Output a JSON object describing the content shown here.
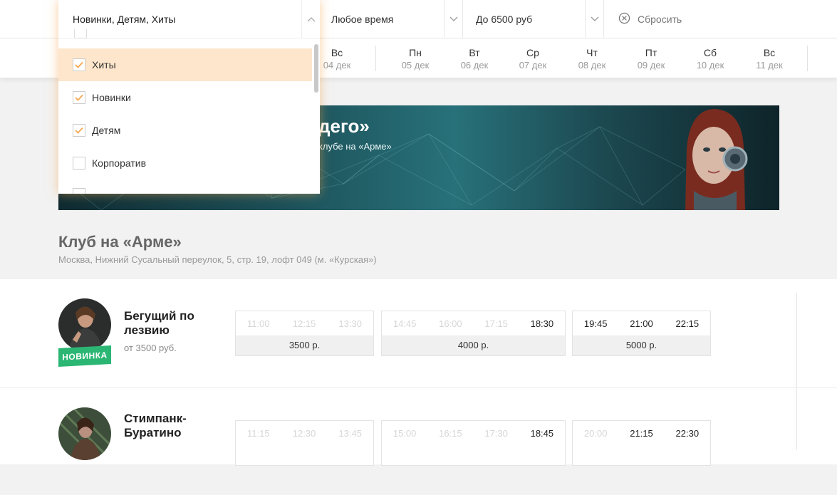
{
  "filters": {
    "category_value": "Новинки, Детям, Хиты",
    "time_value": "Любое время",
    "price_value": "До 6500 руб",
    "reset_label": "Сбросить"
  },
  "dates": [
    {
      "weekday": "Вс",
      "date": "04 дек"
    },
    {
      "weekday": "Пн",
      "date": "05 дек"
    },
    {
      "weekday": "Вт",
      "date": "06 дек"
    },
    {
      "weekday": "Ср",
      "date": "07 дек"
    },
    {
      "weekday": "Чт",
      "date": "08 дек"
    },
    {
      "weekday": "Пт",
      "date": "09 дек"
    },
    {
      "weekday": "Сб",
      "date": "10 дек"
    },
    {
      "weekday": "Вс",
      "date": "11 дек"
    }
  ],
  "dropdown": {
    "items": [
      {
        "label": "Хиты",
        "checked": true
      },
      {
        "label": "Новинки",
        "checked": true
      },
      {
        "label": "Детям",
        "checked": true
      },
      {
        "label": "Корпоратив",
        "checked": false
      }
    ]
  },
  "banner": {
    "title": "дего»",
    "subtitle": "клубе на «Арме»"
  },
  "venue": {
    "name": "Клуб на «Арме»",
    "address": "Москва, Нижний Сусальный переулок, 5, стр. 19, лофт 049 (м. «Курская»)"
  },
  "events": [
    {
      "title": "Бегущий по лезвию",
      "badge": "НОВИНКА",
      "price": "от 3500 руб.",
      "slots": [
        {
          "times": [
            "11:00",
            "12:15",
            "13:30"
          ],
          "price": "3500 р."
        },
        {
          "times": [
            "14:45",
            "16:00",
            "17:15",
            "18:30"
          ],
          "price": "4000 р."
        },
        {
          "times": [
            "19:45",
            "21:00",
            "22:15"
          ],
          "price": "5000 р."
        }
      ]
    },
    {
      "title": "Стимпанк-Буратино",
      "slots": [
        {
          "times": [
            "11:15",
            "12:30",
            "13:45"
          ]
        },
        {
          "times": [
            "15:00",
            "16:15",
            "17:30",
            "18:45"
          ]
        },
        {
          "times": [
            "20:00",
            "21:15",
            "22:30"
          ]
        }
      ]
    }
  ],
  "colors": {
    "accent_orange": "#f5a650",
    "badge_green": "#2bb673",
    "highlight": "#fde6cc"
  }
}
